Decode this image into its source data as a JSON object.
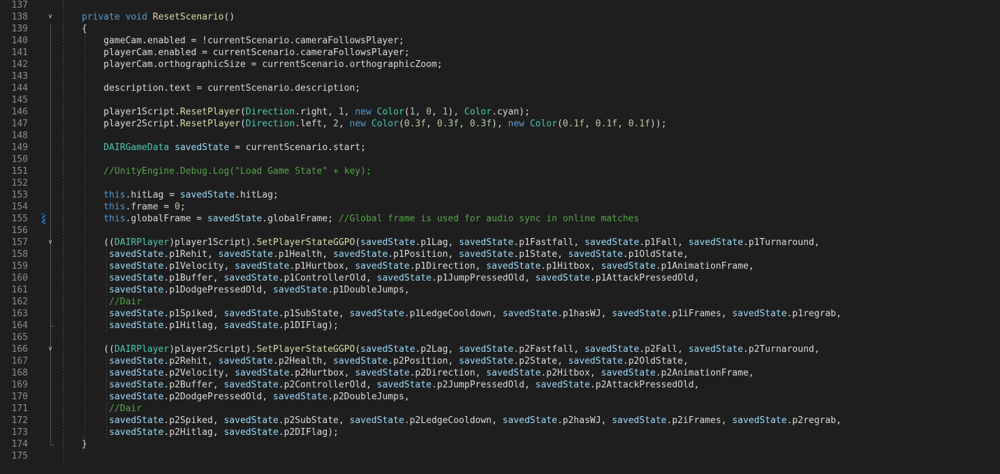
{
  "editor": {
    "language": "C#",
    "colors": {
      "background": "#1e1e1e",
      "keyword": "#569cd6",
      "type": "#4ec9b0",
      "method": "#dcdcaa",
      "number": "#b5cea8",
      "comment": "#57a64a",
      "local": "#9cdcfe",
      "text": "#dcdcdc",
      "line_number": "#8e8e8e",
      "change_marker": "#2f7bd0"
    },
    "lines": [
      {
        "n": "137",
        "indent": 0,
        "tokens": []
      },
      {
        "n": "138",
        "indent": 0,
        "fold": "expanded",
        "tokens": [
          [
            "kw",
            "private void "
          ],
          [
            "mt",
            "ResetScenario"
          ],
          [
            "tx",
            "()"
          ]
        ]
      },
      {
        "n": "139",
        "indent": 0,
        "tokens": [
          [
            "tx",
            "{"
          ]
        ]
      },
      {
        "n": "140",
        "indent": 4,
        "tokens": [
          [
            "tx",
            "gameCam.enabled = !currentScenario.cameraFollowsPlayer;"
          ]
        ]
      },
      {
        "n": "141",
        "indent": 4,
        "tokens": [
          [
            "tx",
            "playerCam.enabled = currentScenario.cameraFollowsPlayer;"
          ]
        ]
      },
      {
        "n": "142",
        "indent": 4,
        "tokens": [
          [
            "tx",
            "playerCam.orthographicSize = currentScenario.orthographicZoom;"
          ]
        ]
      },
      {
        "n": "143",
        "indent": 0,
        "tokens": []
      },
      {
        "n": "144",
        "indent": 4,
        "tokens": [
          [
            "tx",
            "description.text = currentScenario.description;"
          ]
        ]
      },
      {
        "n": "145",
        "indent": 0,
        "tokens": []
      },
      {
        "n": "146",
        "indent": 4,
        "tokens": [
          [
            "tx",
            "player1Script."
          ],
          [
            "mt",
            "ResetPlayer"
          ],
          [
            "tx",
            "("
          ],
          [
            "ty",
            "Direction"
          ],
          [
            "tx",
            ".right, "
          ],
          [
            "nu",
            "1"
          ],
          [
            "tx",
            ", "
          ],
          [
            "kw",
            "new "
          ],
          [
            "ty",
            "Color"
          ],
          [
            "tx",
            "("
          ],
          [
            "nu",
            "1"
          ],
          [
            "tx",
            ", "
          ],
          [
            "nu",
            "0"
          ],
          [
            "tx",
            ", "
          ],
          [
            "nu",
            "1"
          ],
          [
            "tx",
            "), "
          ],
          [
            "ty",
            "Color"
          ],
          [
            "tx",
            ".cyan);"
          ]
        ]
      },
      {
        "n": "147",
        "indent": 4,
        "tokens": [
          [
            "tx",
            "player2Script."
          ],
          [
            "mt",
            "ResetPlayer"
          ],
          [
            "tx",
            "("
          ],
          [
            "ty",
            "Direction"
          ],
          [
            "tx",
            ".left, "
          ],
          [
            "nu",
            "2"
          ],
          [
            "tx",
            ", "
          ],
          [
            "kw",
            "new "
          ],
          [
            "ty",
            "Color"
          ],
          [
            "tx",
            "("
          ],
          [
            "nu",
            "0.3f"
          ],
          [
            "tx",
            ", "
          ],
          [
            "nu",
            "0.3f"
          ],
          [
            "tx",
            ", "
          ],
          [
            "nu",
            "0.3f"
          ],
          [
            "tx",
            "), "
          ],
          [
            "kw",
            "new "
          ],
          [
            "ty",
            "Color"
          ],
          [
            "tx",
            "("
          ],
          [
            "nu",
            "0.1f"
          ],
          [
            "tx",
            ", "
          ],
          [
            "nu",
            "0.1f"
          ],
          [
            "tx",
            ", "
          ],
          [
            "nu",
            "0.1f"
          ],
          [
            "tx",
            "));"
          ]
        ]
      },
      {
        "n": "148",
        "indent": 0,
        "tokens": []
      },
      {
        "n": "149",
        "indent": 4,
        "tokens": [
          [
            "ty",
            "DAIRGameData "
          ],
          [
            "lv",
            "savedState"
          ],
          [
            "tx",
            " = currentScenario.start;"
          ]
        ]
      },
      {
        "n": "150",
        "indent": 0,
        "tokens": []
      },
      {
        "n": "151",
        "indent": 4,
        "tokens": [
          [
            "cm",
            "//UnityEngine.Debug.Log(\"Load Game State\" + key);"
          ]
        ]
      },
      {
        "n": "152",
        "indent": 0,
        "tokens": []
      },
      {
        "n": "153",
        "indent": 4,
        "tokens": [
          [
            "kw",
            "this"
          ],
          [
            "tx",
            ".hitLag = "
          ],
          [
            "lv",
            "savedState"
          ],
          [
            "tx",
            ".hitLag;"
          ]
        ]
      },
      {
        "n": "154",
        "indent": 4,
        "tokens": [
          [
            "kw",
            "this"
          ],
          [
            "tx",
            ".frame = "
          ],
          [
            "nu",
            "0"
          ],
          [
            "tx",
            ";"
          ]
        ]
      },
      {
        "n": "155",
        "indent": 4,
        "changed": true,
        "tokens": [
          [
            "kw",
            "this"
          ],
          [
            "tx",
            ".globalFrame = "
          ],
          [
            "lv",
            "savedState"
          ],
          [
            "tx",
            ".globalFrame; "
          ],
          [
            "cm",
            "//Global frame is used for audio sync in online matches"
          ]
        ]
      },
      {
        "n": "156",
        "indent": 0,
        "tokens": []
      },
      {
        "n": "157",
        "indent": 4,
        "fold": "expanded",
        "tokens": [
          [
            "tx",
            "(("
          ],
          [
            "ty",
            "DAIRPlayer"
          ],
          [
            "tx",
            ")player1Script)."
          ],
          [
            "mt",
            "SetPlayerStateGGPO"
          ],
          [
            "tx",
            "("
          ],
          [
            "lv",
            "savedState"
          ],
          [
            "tx",
            ".p1Lag, "
          ],
          [
            "lv",
            "savedState"
          ],
          [
            "tx",
            ".p1Fastfall, "
          ],
          [
            "lv",
            "savedState"
          ],
          [
            "tx",
            ".p1Fall, "
          ],
          [
            "lv",
            "savedState"
          ],
          [
            "tx",
            ".p1Turnaround,"
          ]
        ]
      },
      {
        "n": "158",
        "indent": 5,
        "tokens": [
          [
            "lv",
            "savedState"
          ],
          [
            "tx",
            ".p1Rehit, "
          ],
          [
            "lv",
            "savedState"
          ],
          [
            "tx",
            ".p1Health, "
          ],
          [
            "lv",
            "savedState"
          ],
          [
            "tx",
            ".p1Position, "
          ],
          [
            "lv",
            "savedState"
          ],
          [
            "tx",
            ".p1State, "
          ],
          [
            "lv",
            "savedState"
          ],
          [
            "tx",
            ".p1OldState,"
          ]
        ]
      },
      {
        "n": "159",
        "indent": 5,
        "tokens": [
          [
            "lv",
            "savedState"
          ],
          [
            "tx",
            ".p1Velocity, "
          ],
          [
            "lv",
            "savedState"
          ],
          [
            "tx",
            ".p1Hurtbox, "
          ],
          [
            "lv",
            "savedState"
          ],
          [
            "tx",
            ".p1Direction, "
          ],
          [
            "lv",
            "savedState"
          ],
          [
            "tx",
            ".p1Hitbox, "
          ],
          [
            "lv",
            "savedState"
          ],
          [
            "tx",
            ".p1AnimationFrame,"
          ]
        ]
      },
      {
        "n": "160",
        "indent": 5,
        "tokens": [
          [
            "lv",
            "savedState"
          ],
          [
            "tx",
            ".p1Buffer, "
          ],
          [
            "lv",
            "savedState"
          ],
          [
            "tx",
            ".p1ControllerOld, "
          ],
          [
            "lv",
            "savedState"
          ],
          [
            "tx",
            ".p1JumpPressedOld, "
          ],
          [
            "lv",
            "savedState"
          ],
          [
            "tx",
            ".p1AttackPressedOld,"
          ]
        ]
      },
      {
        "n": "161",
        "indent": 5,
        "tokens": [
          [
            "lv",
            "savedState"
          ],
          [
            "tx",
            ".p1DodgePressedOld, "
          ],
          [
            "lv",
            "savedState"
          ],
          [
            "tx",
            ".p1DoubleJumps,"
          ]
        ]
      },
      {
        "n": "162",
        "indent": 5,
        "tokens": [
          [
            "cm",
            "//Dair"
          ]
        ]
      },
      {
        "n": "163",
        "indent": 5,
        "tokens": [
          [
            "lv",
            "savedState"
          ],
          [
            "tx",
            ".p1Spiked, "
          ],
          [
            "lv",
            "savedState"
          ],
          [
            "tx",
            ".p1SubState, "
          ],
          [
            "lv",
            "savedState"
          ],
          [
            "tx",
            ".p1LedgeCooldown, "
          ],
          [
            "lv",
            "savedState"
          ],
          [
            "tx",
            ".p1hasWJ, "
          ],
          [
            "lv",
            "savedState"
          ],
          [
            "tx",
            ".p1iFrames, "
          ],
          [
            "lv",
            "savedState"
          ],
          [
            "tx",
            ".p1regrab,"
          ]
        ]
      },
      {
        "n": "164",
        "indent": 5,
        "fold": "end",
        "tokens": [
          [
            "lv",
            "savedState"
          ],
          [
            "tx",
            ".p1Hitlag, "
          ],
          [
            "lv",
            "savedState"
          ],
          [
            "tx",
            ".p1DIFlag);"
          ]
        ]
      },
      {
        "n": "165",
        "indent": 0,
        "tokens": []
      },
      {
        "n": "166",
        "indent": 4,
        "fold": "expanded",
        "tokens": [
          [
            "tx",
            "(("
          ],
          [
            "ty",
            "DAIRPlayer"
          ],
          [
            "tx",
            ")player2Script)."
          ],
          [
            "mt",
            "SetPlayerStateGGPO"
          ],
          [
            "tx",
            "("
          ],
          [
            "lv",
            "savedState"
          ],
          [
            "tx",
            ".p2Lag, "
          ],
          [
            "lv",
            "savedState"
          ],
          [
            "tx",
            ".p2Fastfall, "
          ],
          [
            "lv",
            "savedState"
          ],
          [
            "tx",
            ".p2Fall, "
          ],
          [
            "lv",
            "savedState"
          ],
          [
            "tx",
            ".p2Turnaround,"
          ]
        ]
      },
      {
        "n": "167",
        "indent": 5,
        "tokens": [
          [
            "lv",
            "savedState"
          ],
          [
            "tx",
            ".p2Rehit, "
          ],
          [
            "lv",
            "savedState"
          ],
          [
            "tx",
            ".p2Health, "
          ],
          [
            "lv",
            "savedState"
          ],
          [
            "tx",
            ".p2Position, "
          ],
          [
            "lv",
            "savedState"
          ],
          [
            "tx",
            ".p2State, "
          ],
          [
            "lv",
            "savedState"
          ],
          [
            "tx",
            ".p2OldState,"
          ]
        ]
      },
      {
        "n": "168",
        "indent": 5,
        "tokens": [
          [
            "lv",
            "savedState"
          ],
          [
            "tx",
            ".p2Velocity, "
          ],
          [
            "lv",
            "savedState"
          ],
          [
            "tx",
            ".p2Hurtbox, "
          ],
          [
            "lv",
            "savedState"
          ],
          [
            "tx",
            ".p2Direction, "
          ],
          [
            "lv",
            "savedState"
          ],
          [
            "tx",
            ".p2Hitbox, "
          ],
          [
            "lv",
            "savedState"
          ],
          [
            "tx",
            ".p2AnimationFrame,"
          ]
        ]
      },
      {
        "n": "169",
        "indent": 5,
        "tokens": [
          [
            "lv",
            "savedState"
          ],
          [
            "tx",
            ".p2Buffer, "
          ],
          [
            "lv",
            "savedState"
          ],
          [
            "tx",
            ".p2ControllerOld, "
          ],
          [
            "lv",
            "savedState"
          ],
          [
            "tx",
            ".p2JumpPressedOld, "
          ],
          [
            "lv",
            "savedState"
          ],
          [
            "tx",
            ".p2AttackPressedOld,"
          ]
        ]
      },
      {
        "n": "170",
        "indent": 5,
        "tokens": [
          [
            "lv",
            "savedState"
          ],
          [
            "tx",
            ".p2DodgePressedOld, "
          ],
          [
            "lv",
            "savedState"
          ],
          [
            "tx",
            ".p2DoubleJumps,"
          ]
        ]
      },
      {
        "n": "171",
        "indent": 5,
        "tokens": [
          [
            "cm",
            "//Dair"
          ]
        ]
      },
      {
        "n": "172",
        "indent": 5,
        "tokens": [
          [
            "lv",
            "savedState"
          ],
          [
            "tx",
            ".p2Spiked, "
          ],
          [
            "lv",
            "savedState"
          ],
          [
            "tx",
            ".p2SubState, "
          ],
          [
            "lv",
            "savedState"
          ],
          [
            "tx",
            ".p2LedgeCooldown, "
          ],
          [
            "lv",
            "savedState"
          ],
          [
            "tx",
            ".p2hasWJ, "
          ],
          [
            "lv",
            "savedState"
          ],
          [
            "tx",
            ".p2iFrames, "
          ],
          [
            "lv",
            "savedState"
          ],
          [
            "tx",
            ".p2regrab,"
          ]
        ]
      },
      {
        "n": "173",
        "indent": 5,
        "tokens": [
          [
            "lv",
            "savedState"
          ],
          [
            "tx",
            ".p2Hitlag, "
          ],
          [
            "lv",
            "savedState"
          ],
          [
            "tx",
            ".p2DIFlag);"
          ]
        ]
      },
      {
        "n": "174",
        "indent": 0,
        "fold": "end",
        "tokens": [
          [
            "tx",
            "}"
          ]
        ]
      },
      {
        "n": "175",
        "indent": 0,
        "tokens": []
      }
    ]
  }
}
